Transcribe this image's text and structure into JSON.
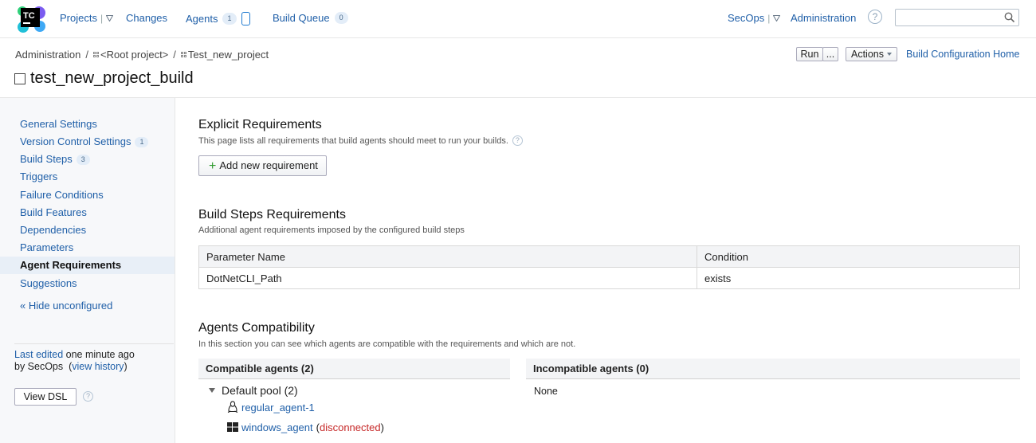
{
  "header": {
    "logo_text": "TC",
    "projects": "Projects",
    "changes": "Changes",
    "agents": "Agents",
    "agents_count": "1",
    "build_queue": "Build Queue",
    "build_queue_count": "0",
    "user": "SecOps",
    "administration": "Administration",
    "help": "?",
    "search_placeholder": ""
  },
  "breadcrumb": {
    "admin": "Administration",
    "root": "<Root project>",
    "project": "Test_new_project"
  },
  "page_title": "test_new_project_build",
  "toolbar": {
    "run": "Run",
    "more": "...",
    "actions": "Actions",
    "home": "Build Configuration Home"
  },
  "sidebar": {
    "items": [
      {
        "label": "General Settings",
        "badge": ""
      },
      {
        "label": "Version Control Settings",
        "badge": "1"
      },
      {
        "label": "Build Steps",
        "badge": "3"
      },
      {
        "label": "Triggers",
        "badge": ""
      },
      {
        "label": "Failure Conditions",
        "badge": ""
      },
      {
        "label": "Build Features",
        "badge": ""
      },
      {
        "label": "Dependencies",
        "badge": ""
      },
      {
        "label": "Parameters",
        "badge": ""
      },
      {
        "label": "Agent Requirements",
        "badge": ""
      },
      {
        "label": "Suggestions",
        "badge": ""
      }
    ],
    "hide_unconfigured": "« Hide unconfigured",
    "last_edited_link": "Last edited",
    "last_edited_rest": " one minute ago",
    "by": "by SecOps",
    "view_history": "view history",
    "view_dsl": "View DSL",
    "help": "?"
  },
  "explicit": {
    "title": "Explicit Requirements",
    "desc": "This page lists all requirements that build agents should meet to run your builds.",
    "add_button": "Add new requirement"
  },
  "steps_req": {
    "title": "Build Steps Requirements",
    "desc": "Additional agent requirements imposed by the configured build steps",
    "col_param": "Parameter Name",
    "col_cond": "Condition",
    "rows": [
      {
        "param": "DotNetCLI_Path",
        "condition": "exists"
      }
    ]
  },
  "compat": {
    "title": "Agents Compatibility",
    "desc": "In this section you can see which agents are compatible with the requirements and which are not.",
    "compatible_head": "Compatible agents (2)",
    "incompatible_head": "Incompatible agents (0)",
    "pool": "Default pool (2)",
    "agent1": "regular_agent-1",
    "agent2": "windows_agent",
    "agent2_status": "disconnected",
    "none": "None"
  },
  "colors": {
    "link": "#1f5fa8",
    "disconnected": "#c62828",
    "add_plus": "#2e9a2e"
  }
}
